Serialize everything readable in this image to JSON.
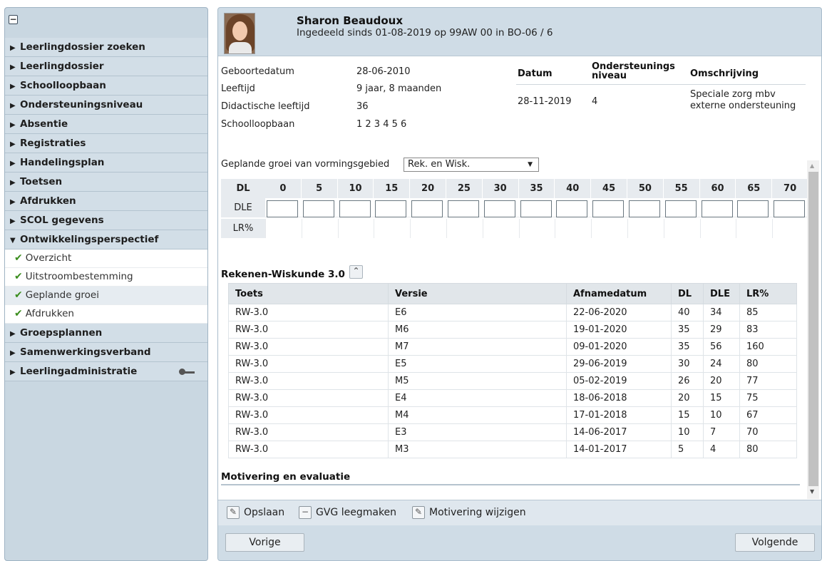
{
  "sidebar": {
    "items": [
      {
        "label": "Leerlingdossier zoeken"
      },
      {
        "label": "Leerlingdossier"
      },
      {
        "label": "Schoolloopbaan"
      },
      {
        "label": "Ondersteuningsniveau"
      },
      {
        "label": "Absentie"
      },
      {
        "label": "Registraties"
      },
      {
        "label": "Handelingsplan"
      },
      {
        "label": "Toetsen"
      },
      {
        "label": "Afdrukken"
      },
      {
        "label": "SCOL gegevens"
      },
      {
        "label": "Ontwikkelingsperspectief"
      },
      {
        "label": "Groepsplannen"
      },
      {
        "label": "Samenwerkingsverband"
      },
      {
        "label": "Leerlingadministratie"
      }
    ],
    "subitems": [
      {
        "label": "Overzicht"
      },
      {
        "label": "Uitstroombestemming"
      },
      {
        "label": "Geplande groei"
      },
      {
        "label": "Afdrukken"
      }
    ]
  },
  "header": {
    "name": "Sharon Beaudoux",
    "subtitle": "Ingedeeld sinds 01-08-2019 op 99AW 00 in BO-06 / 6"
  },
  "info": {
    "rows": [
      {
        "label": "Geboortedatum",
        "value": "28-06-2010"
      },
      {
        "label": "Leeftijd",
        "value": "9 jaar, 8 maanden"
      },
      {
        "label": "Didactische leeftijd",
        "value": "36"
      },
      {
        "label": "Schoolloopbaan",
        "value": "1 2 3 4 5 6"
      }
    ]
  },
  "ondersteuning": {
    "headers": {
      "datum": "Datum",
      "niveau": "Ondersteunings niveau",
      "omschrijving": "Omschrijving"
    },
    "row": {
      "datum": "28-11-2019",
      "niveau": "4",
      "omschrijving": "Speciale zorg mbv externe ondersteuning"
    }
  },
  "groei": {
    "label": "Geplande groei van vormingsgebied",
    "selected": "Rek. en Wisk.",
    "dl_header": "DL",
    "dl_values": [
      "0",
      "5",
      "10",
      "15",
      "20",
      "25",
      "30",
      "35",
      "40",
      "45",
      "50",
      "55",
      "60",
      "65",
      "70"
    ],
    "row2_label": "DLE",
    "row3_label": "LR%"
  },
  "section": {
    "title": "Rekenen-Wiskunde 3.0",
    "collapse_glyph": "⌃"
  },
  "table": {
    "headers": [
      "Toets",
      "Versie",
      "Afnamedatum",
      "DL",
      "DLE",
      "LR%"
    ],
    "rows": [
      [
        "RW-3.0",
        "E6",
        "22-06-2020",
        "40",
        "34",
        "85"
      ],
      [
        "RW-3.0",
        "M6",
        "19-01-2020",
        "35",
        "29",
        "83"
      ],
      [
        "RW-3.0",
        "M7",
        "09-01-2020",
        "35",
        "56",
        "160"
      ],
      [
        "RW-3.0",
        "E5",
        "29-06-2019",
        "30",
        "24",
        "80"
      ],
      [
        "RW-3.0",
        "M5",
        "05-02-2019",
        "26",
        "20",
        "77"
      ],
      [
        "RW-3.0",
        "E4",
        "18-06-2018",
        "20",
        "15",
        "75"
      ],
      [
        "RW-3.0",
        "M4",
        "17-01-2018",
        "15",
        "10",
        "67"
      ],
      [
        "RW-3.0",
        "E3",
        "14-06-2017",
        "10",
        "7",
        "70"
      ],
      [
        "RW-3.0",
        "M3",
        "14-01-2017",
        "5",
        "4",
        "80"
      ]
    ]
  },
  "motivering": {
    "title": "Motivering en evaluatie"
  },
  "toolbar": {
    "save": "Opslaan",
    "clear": "GVG leegmaken",
    "edit_motivation": "Motivering wijzigen"
  },
  "nav": {
    "prev": "Vorige",
    "next": "Volgende"
  },
  "colors": {
    "check": "#3a8d1d",
    "sidebar_bg": "#c9d7e1",
    "header_bg": "#cfdce6"
  }
}
